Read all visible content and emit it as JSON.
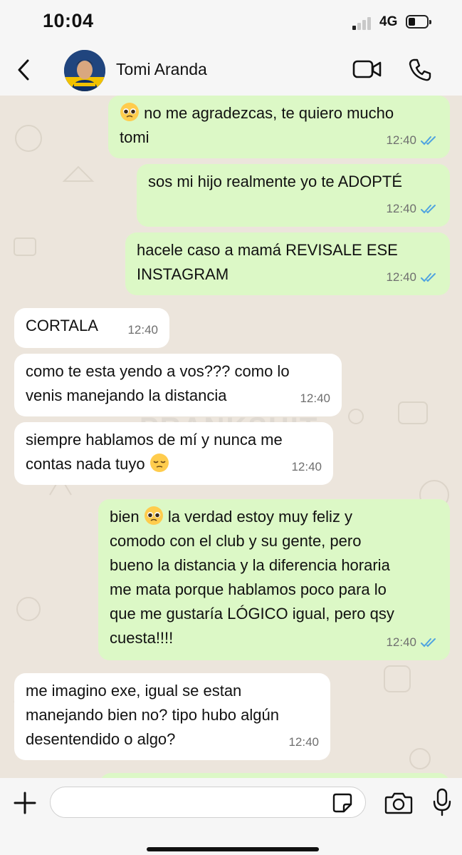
{
  "status_bar": {
    "time": "10:04",
    "network": "4G"
  },
  "header": {
    "contact_name": "Tomi Aranda"
  },
  "watermark": "PRANKSHIT",
  "messages": [
    {
      "dir": "out",
      "text": "no me agradezcas, te quiero mucho tomi",
      "lines": [
        "no me agradezcas, te quiero mucho",
        "tomi"
      ],
      "emoji_prefix": "pleading-face",
      "time": "12:40",
      "read": true
    },
    {
      "dir": "out",
      "text": "sos mi hijo realmente yo te ADOPTÉ",
      "time": "12:40",
      "read": true
    },
    {
      "dir": "out",
      "text": "hacele caso a mamá REVISALE ESE INSTAGRAM",
      "lines": [
        "hacele caso a mamá REVISALE ESE",
        "INSTAGRAM"
      ],
      "time": "12:40",
      "read": true
    },
    {
      "dir": "in",
      "text": "CORTALA",
      "time": "12:40"
    },
    {
      "dir": "in",
      "text": "como te esta yendo a vos??? como lo venis manejando la distancia",
      "lines": [
        "como te esta yendo a vos??? como lo",
        "venis manejando la distancia"
      ],
      "time": "12:40"
    },
    {
      "dir": "in",
      "text": "siempre hablamos de mí y nunca me contas nada tuyo",
      "lines": [
        "siempre hablamos de mí y nunca me",
        "contas nada tuyo"
      ],
      "emoji_suffix": "pensive-face",
      "time": "12:40"
    },
    {
      "dir": "out",
      "text": "bien la verdad estoy muy feliz y comodo con el club y su gente, pero bueno la distancia y la diferencia horaria me mata porque hablamos poco para lo que me gustaría LÓGICO igual, pero qsy cuesta!!!!",
      "lines": [
        "bien",
        "la verdad estoy muy feliz y",
        "comodo con el club y su gente, pero",
        "bueno la distancia y la diferencia horaria",
        "me mata porque hablamos poco para lo",
        "que me gustaría LÓGICO igual, pero qsy",
        "cuesta!!!!"
      ],
      "emoji_inline": "pleading-face",
      "time": "12:40",
      "read": true
    },
    {
      "dir": "in",
      "text": "me imagino exe, igual se estan manejando bien no? tipo hubo algún desentendido o algo?",
      "lines": [
        "me imagino exe, igual se estan",
        "manejando bien no? tipo hubo algún",
        "desentendido o algo?"
      ],
      "time": "12:40"
    }
  ],
  "input": {
    "placeholder": ""
  },
  "icons": {
    "back": "chevron-left-icon",
    "video": "video-camera-icon",
    "phone": "phone-icon",
    "plus": "plus-icon",
    "sticker": "sticker-icon",
    "camera": "camera-icon",
    "mic": "microphone-icon",
    "read_ticks": "double-check-icon"
  },
  "colors": {
    "outgoing_bubble": "#dcf8c6",
    "incoming_bubble": "#ffffff",
    "read_ticks": "#4fa3e0",
    "chat_background": "#ece5dc"
  }
}
